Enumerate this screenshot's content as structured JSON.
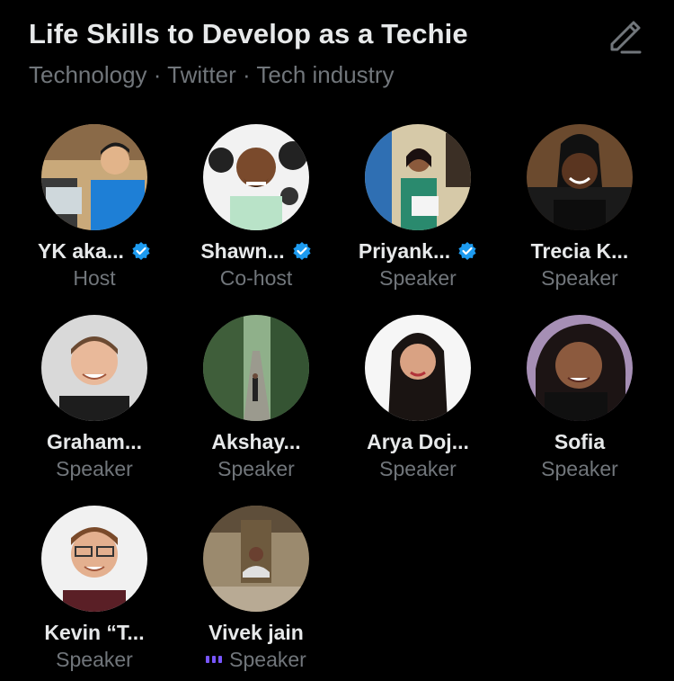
{
  "space": {
    "title": "Life Skills to Develop as a Techie",
    "topics": "Technology · Twitter · Tech industry"
  },
  "colors": {
    "background": "#000000",
    "primary_text": "#e7e9ea",
    "secondary_text": "#71767b",
    "verified": "#1d9bf0",
    "speaking_indicator": "#7856ff"
  },
  "participants": [
    {
      "name": "YK aka...",
      "role": "Host",
      "verified": true
    },
    {
      "name": "Shawn...",
      "role": "Co-host",
      "verified": true
    },
    {
      "name": "Priyank...",
      "role": "Speaker",
      "verified": true
    },
    {
      "name": "Trecia K...",
      "role": "Speaker",
      "verified": false
    },
    {
      "name": "Graham...",
      "role": "Speaker",
      "verified": false
    },
    {
      "name": "Akshay...",
      "role": "Speaker",
      "verified": false
    },
    {
      "name": "Arya Doj...",
      "role": "Speaker",
      "verified": false
    },
    {
      "name": "Sofia",
      "role": "Speaker",
      "verified": false
    },
    {
      "name": "Kevin “T...",
      "role": "Speaker",
      "verified": false
    },
    {
      "name": "Vivek jain",
      "role": "Speaker",
      "verified": false,
      "speaking": true
    }
  ],
  "icons": {
    "edit": "pencil-icon",
    "verified": "verified-badge-icon",
    "speaking": "speaking-indicator-icon"
  }
}
